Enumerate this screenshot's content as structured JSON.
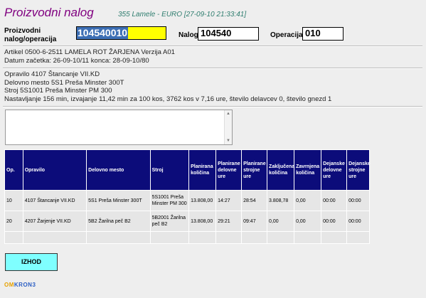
{
  "header": {
    "title": "Proizvodni nalog",
    "subtitle": "355 Lamele - EURO [27-09-10 21:33:41]"
  },
  "form": {
    "nalog_operacija_label_1": "Proizvodni",
    "nalog_operacija_label_2": "nalog/operacija",
    "nalog_operacija_value": "104540010",
    "nalog_label": "Nalog",
    "nalog_value": "104540",
    "operacija_label": "Operacija",
    "operacija_value": "010"
  },
  "article": {
    "line1": "Artikel 0500-6-2511 LAMELA ROT ŽARJENA Verzija A01",
    "line2": "Datum začetka: 26-09-10/11 konca: 28-09-10/80"
  },
  "operation": {
    "line1": "Opravilo 4107 Štancanje VII.KD",
    "line2": "Delovno mesto 5S1 Preša Minster 300T",
    "line3": "Stroj 5S1001 Preša Minster PM 300",
    "line4": "Nastavljanje 156 min, izvajanje 11,42 min za 100 kos, 3762 kos v 7,16 ure, število delavcev 0, število gnezd 1"
  },
  "table": {
    "headers": [
      "Op.",
      "Opravilo",
      "Delovno mesto",
      "Stroj",
      "Planirana količina",
      "Planirane delovne ure",
      "Planirane strojne ure",
      "Zaključena količina",
      "Zavrnjena količina",
      "Dejanske delovne ure",
      "Dejanske strojne ure"
    ],
    "rows": [
      [
        "10",
        "4107 Štancanje VII.KD",
        "5S1 Preša Minster 300T",
        "5S1001 Preša Minster PM 300",
        "13.808,00",
        "14:27",
        "28:54",
        "3.808,78",
        "0,00",
        "00:00",
        "00:00"
      ],
      [
        "20",
        "4207 Žarjenje VII.KD",
        "5B2 Žarilna peč B2",
        "5B2001 Žarilna peč B2",
        "13.808,00",
        "29:21",
        "09:47",
        "0,00",
        "0,00",
        "00:00",
        "00:00"
      ]
    ]
  },
  "buttons": {
    "exit_label": "IZHOD"
  },
  "logo": {
    "part1": "OM",
    "part2": "KRON",
    "part3": "3"
  },
  "colors": {
    "title": "#800080",
    "subtitle": "#2e7d6e",
    "table_header_bg": "#0c0c7a",
    "exit_button_bg": "#7fffff",
    "selected_input_bg": "#ffff00",
    "selection_highlight": "#3d6fb5"
  }
}
